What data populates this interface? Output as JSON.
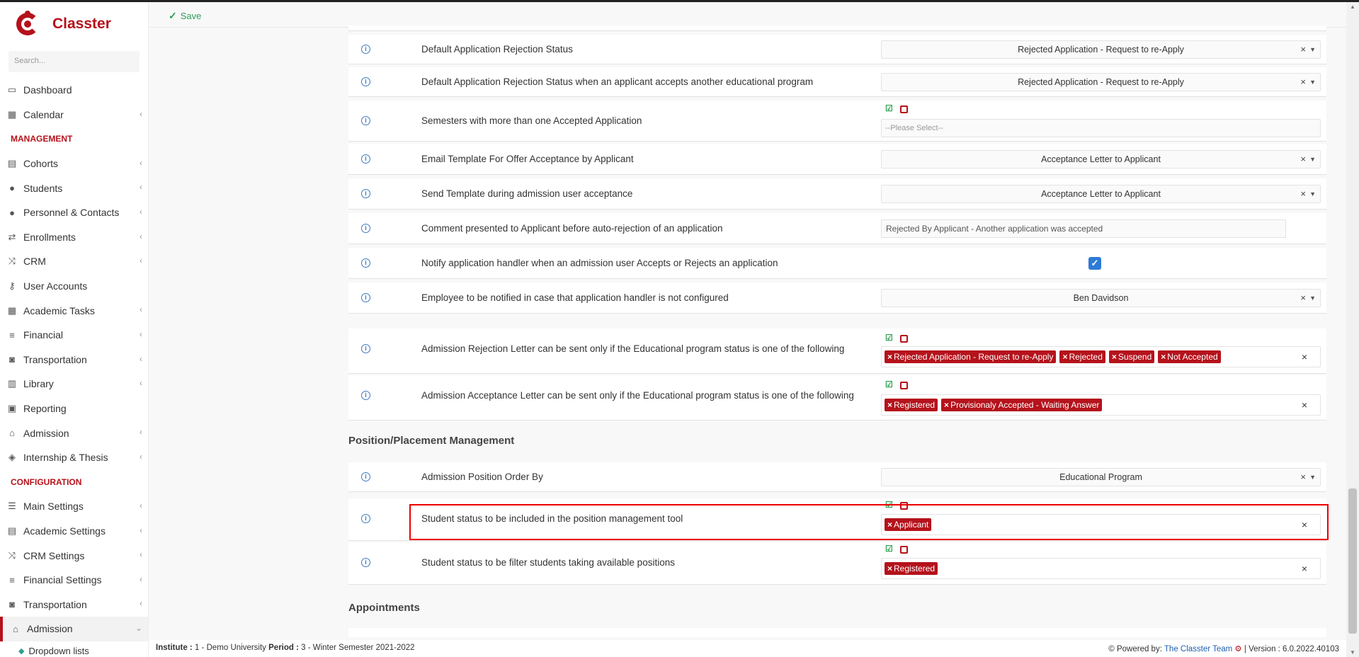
{
  "app": {
    "name": "Classter",
    "search_placeholder": "Search..."
  },
  "toolbar": {
    "save_label": "Save"
  },
  "sidebar": {
    "top_items": [
      {
        "label": "Dashboard",
        "icon": "laptop-icon"
      },
      {
        "label": "Calendar",
        "icon": "calendar-icon"
      }
    ],
    "management_heading": "MANAGEMENT",
    "management_items": [
      {
        "label": "Cohorts"
      },
      {
        "label": "Students"
      },
      {
        "label": "Personnel & Contacts"
      },
      {
        "label": "Enrollments"
      },
      {
        "label": "CRM"
      },
      {
        "label": "User Accounts"
      },
      {
        "label": "Academic Tasks"
      },
      {
        "label": "Financial"
      },
      {
        "label": "Transportation"
      },
      {
        "label": "Library"
      },
      {
        "label": "Reporting"
      },
      {
        "label": "Admission"
      },
      {
        "label": "Internship & Thesis"
      }
    ],
    "configuration_heading": "CONFIGURATION",
    "configuration_items": [
      {
        "label": "Main Settings"
      },
      {
        "label": "Academic Settings"
      },
      {
        "label": "CRM Settings"
      },
      {
        "label": "Financial Settings"
      },
      {
        "label": "Transportation"
      },
      {
        "label": "Admission"
      }
    ],
    "sub_item": "Dropdown lists"
  },
  "settings": {
    "rows": [
      {
        "label": "Default Application Rejection Status",
        "value": "Rejected Application - Request to re-Apply"
      },
      {
        "label": "Default Application Rejection Status when an applicant accepts another educational program",
        "value": "Rejected Application - Request to re-Apply"
      },
      {
        "label": "Semesters with more than one Accepted Application",
        "placeholder": "--Please Select--"
      },
      {
        "label": "Email Template For Offer Acceptance by Applicant",
        "value": "Acceptance Letter to Applicant"
      },
      {
        "label": "Send Template during admission user acceptance",
        "value": "Acceptance Letter to Applicant"
      },
      {
        "label": "Comment presented to Applicant before auto-rejection of an application",
        "value": "Rejected By Applicant - Another application was accepted"
      },
      {
        "label": "Notify application handler when an admission user Accepts or Rejects an application",
        "checked": true
      },
      {
        "label": "Employee to be notified in case that application handler is not configured",
        "value": "Ben Davidson"
      },
      {
        "label": "Admission Rejection Letter can be sent only if the Educational program status is one of the following",
        "tags": [
          "Rejected Application - Request to re-Apply",
          "Rejected",
          "Suspend",
          "Not Accepted"
        ]
      },
      {
        "label": "Admission Acceptance Letter can be sent only if the Educational program status is one of the following",
        "tags": [
          "Registered",
          "Provisionaly Accepted - Waiting Answer"
        ]
      }
    ],
    "section_position": "Position/Placement Management",
    "position_rows": [
      {
        "label": "Admission Position Order By",
        "value": "Educational Program"
      },
      {
        "label": "Student status to be included in the position management tool",
        "tags": [
          "Applicant"
        ]
      },
      {
        "label": "Student status to be filter students taking available positions",
        "tags": [
          "Registered"
        ]
      }
    ],
    "section_appointments": "Appointments"
  },
  "footer": {
    "institute_label": "Institute :",
    "institute_value": "1 - Demo University",
    "period_label": "Period :",
    "period_value": "3 - Winter Semester 2021-2022",
    "powered_by": "Powered by:",
    "team": "The Classter Team",
    "version": "| Version : 6.0.2022.40103"
  },
  "colors": {
    "brand": "#b5121b",
    "save": "#2e9e5a",
    "info": "#3c79c0",
    "checkbox": "#2d7bd6"
  }
}
